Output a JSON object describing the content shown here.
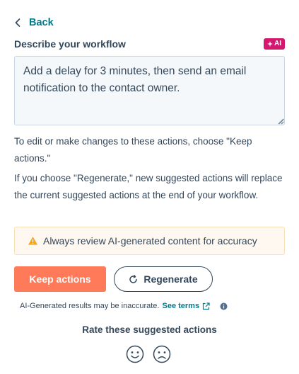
{
  "back": {
    "label": "Back"
  },
  "prompt": {
    "label": "Describe your workflow",
    "ai_badge": "AI",
    "value": "Add a delay for 3 minutes, then send an email notification to the contact owner."
  },
  "help": {
    "edit_text": "To edit or make changes to these actions, choose \"Keep actions.\"",
    "regenerate_text": "If you choose \"Regenerate,\" new suggested actions will replace the current suggested actions at the end of your workflow."
  },
  "alert": {
    "text": "Always review AI-generated content for accuracy",
    "icon": "warning-icon"
  },
  "actions": {
    "keep_label": "Keep actions",
    "regenerate_label": "Regenerate"
  },
  "disclaimer": {
    "text": "AI-Generated results may be inaccurate.",
    "terms_link": "See terms"
  },
  "rating": {
    "title": "Rate these suggested actions"
  },
  "colors": {
    "accent_teal": "#007a8c",
    "primary_orange": "#ff7a59",
    "text": "#33475b",
    "ai_badge": "#d3186f",
    "alert_bg": "#fef8f0",
    "warning": "#f5a623"
  }
}
